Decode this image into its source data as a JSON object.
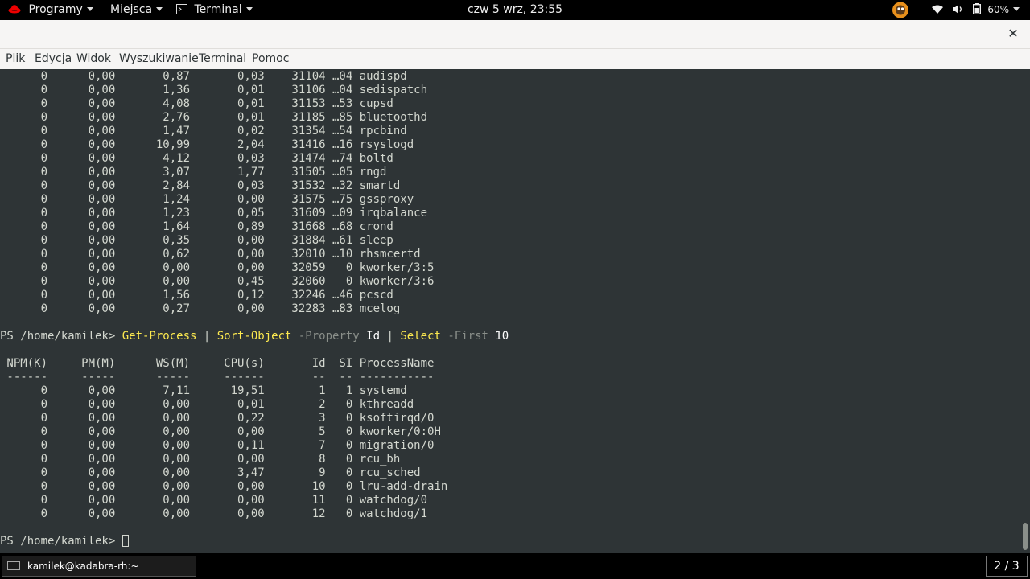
{
  "topbar": {
    "apps_label": "Programy",
    "places_label": "Miejsca",
    "terminal_label": "Terminal",
    "clock": "czw 5 wrz, 23:55",
    "battery_percent": "60%",
    "icons": [
      "redhat-logo-icon",
      "terminal-app-icon",
      "avatar-icon",
      "wifi-icon",
      "volume-icon",
      "battery-icon"
    ]
  },
  "titlebar": {
    "close_label": "✕"
  },
  "menubar": {
    "items": [
      "Plik",
      "Edycja",
      "Widok",
      "Wyszukiwanie",
      "Terminal",
      "Pomoc"
    ]
  },
  "terminal": {
    "columns": [
      "NPM(K)",
      "PM(M)",
      "WS(M)",
      "CPU(s)",
      "Id",
      "SI",
      "ProcessName"
    ],
    "prev_rows": [
      [
        "0",
        "0,00",
        "0,87",
        "0,03",
        "31104",
        "…04",
        "audispd"
      ],
      [
        "0",
        "0,00",
        "1,36",
        "0,01",
        "31106",
        "…04",
        "sedispatch"
      ],
      [
        "0",
        "0,00",
        "4,08",
        "0,01",
        "31153",
        "…53",
        "cupsd"
      ],
      [
        "0",
        "0,00",
        "2,76",
        "0,01",
        "31185",
        "…85",
        "bluetoothd"
      ],
      [
        "0",
        "0,00",
        "1,47",
        "0,02",
        "31354",
        "…54",
        "rpcbind"
      ],
      [
        "0",
        "0,00",
        "10,99",
        "2,04",
        "31416",
        "…16",
        "rsyslogd"
      ],
      [
        "0",
        "0,00",
        "4,12",
        "0,03",
        "31474",
        "…74",
        "boltd"
      ],
      [
        "0",
        "0,00",
        "3,07",
        "1,77",
        "31505",
        "…05",
        "rngd"
      ],
      [
        "0",
        "0,00",
        "2,84",
        "0,03",
        "31532",
        "…32",
        "smartd"
      ],
      [
        "0",
        "0,00",
        "1,24",
        "0,00",
        "31575",
        "…75",
        "gssproxy"
      ],
      [
        "0",
        "0,00",
        "1,23",
        "0,05",
        "31609",
        "…09",
        "irqbalance"
      ],
      [
        "0",
        "0,00",
        "1,64",
        "0,89",
        "31668",
        "…68",
        "crond"
      ],
      [
        "0",
        "0,00",
        "0,35",
        "0,00",
        "31884",
        "…61",
        "sleep"
      ],
      [
        "0",
        "0,00",
        "0,62",
        "0,00",
        "32010",
        "…10",
        "rhsmcertd"
      ],
      [
        "0",
        "0,00",
        "0,00",
        "0,00",
        "32059",
        "0",
        "kworker/3:5"
      ],
      [
        "0",
        "0,00",
        "0,00",
        "0,45",
        "32060",
        "0",
        "kworker/3:6"
      ],
      [
        "0",
        "0,00",
        "1,56",
        "0,12",
        "32246",
        "…46",
        "pcscd"
      ],
      [
        "0",
        "0,00",
        "0,27",
        "0,00",
        "32283",
        "…83",
        "mcelog"
      ]
    ],
    "prompt": "PS /home/kamilek> ",
    "command": [
      {
        "t": "Get-Process",
        "c": "kw"
      },
      {
        "t": " | ",
        "c": "plain"
      },
      {
        "t": "Sort-Object",
        "c": "kw"
      },
      {
        "t": " -Property",
        "c": "par"
      },
      {
        "t": " Id",
        "c": "arg"
      },
      {
        "t": " | ",
        "c": "plain"
      },
      {
        "t": "Select",
        "c": "kw"
      },
      {
        "t": " -First",
        "c": "par"
      },
      {
        "t": " 10",
        "c": "arg"
      }
    ],
    "rows": [
      [
        "0",
        "0,00",
        "7,11",
        "19,51",
        "1",
        "1",
        "systemd"
      ],
      [
        "0",
        "0,00",
        "0,00",
        "0,01",
        "2",
        "0",
        "kthreadd"
      ],
      [
        "0",
        "0,00",
        "0,00",
        "0,22",
        "3",
        "0",
        "ksoftirqd/0"
      ],
      [
        "0",
        "0,00",
        "0,00",
        "0,00",
        "5",
        "0",
        "kworker/0:0H"
      ],
      [
        "0",
        "0,00",
        "0,00",
        "0,11",
        "7",
        "0",
        "migration/0"
      ],
      [
        "0",
        "0,00",
        "0,00",
        "0,00",
        "8",
        "0",
        "rcu_bh"
      ],
      [
        "0",
        "0,00",
        "0,00",
        "3,47",
        "9",
        "0",
        "rcu_sched"
      ],
      [
        "0",
        "0,00",
        "0,00",
        "0,00",
        "10",
        "0",
        "lru-add-drain"
      ],
      [
        "0",
        "0,00",
        "0,00",
        "0,00",
        "11",
        "0",
        "watchdog/0"
      ],
      [
        "0",
        "0,00",
        "0,00",
        "0,00",
        "12",
        "0",
        "watchdog/1"
      ]
    ],
    "final_prompt": "PS /home/kamilek> "
  },
  "taskbar": {
    "window_label": "kamilek@kadabra-rh:~",
    "workspace": "2 / 3"
  },
  "colors": {
    "terminal_bg": "#2e3436",
    "terminal_fg": "#d3d7cf",
    "keyword": "#fce94f",
    "parameter": "#8a8f8a"
  }
}
